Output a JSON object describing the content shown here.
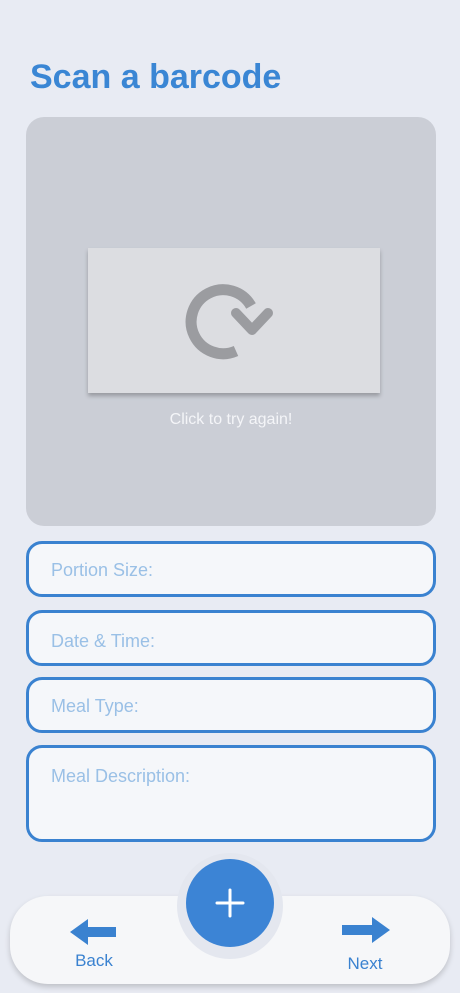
{
  "page": {
    "title": "Scan a barcode"
  },
  "scanner": {
    "retry_text": "Click to try again!",
    "retry_icon": "refresh-icon"
  },
  "form": {
    "portion_size_placeholder": "Portion Size:",
    "date_time_placeholder": "Date & Time:",
    "meal_type_placeholder": "Meal Type:",
    "meal_description_placeholder": "Meal Description:"
  },
  "bottom_nav": {
    "back_label": "Back",
    "next_label": "Next",
    "add_icon": "plus-icon",
    "back_icon": "arrow-left-icon",
    "next_icon": "arrow-right-icon"
  },
  "colors": {
    "accent": "#3a86d4",
    "background": "#e8ebf3",
    "scanner_bg": "#cbced6",
    "field_border": "#3a82d0",
    "placeholder": "#9ac0e6"
  }
}
